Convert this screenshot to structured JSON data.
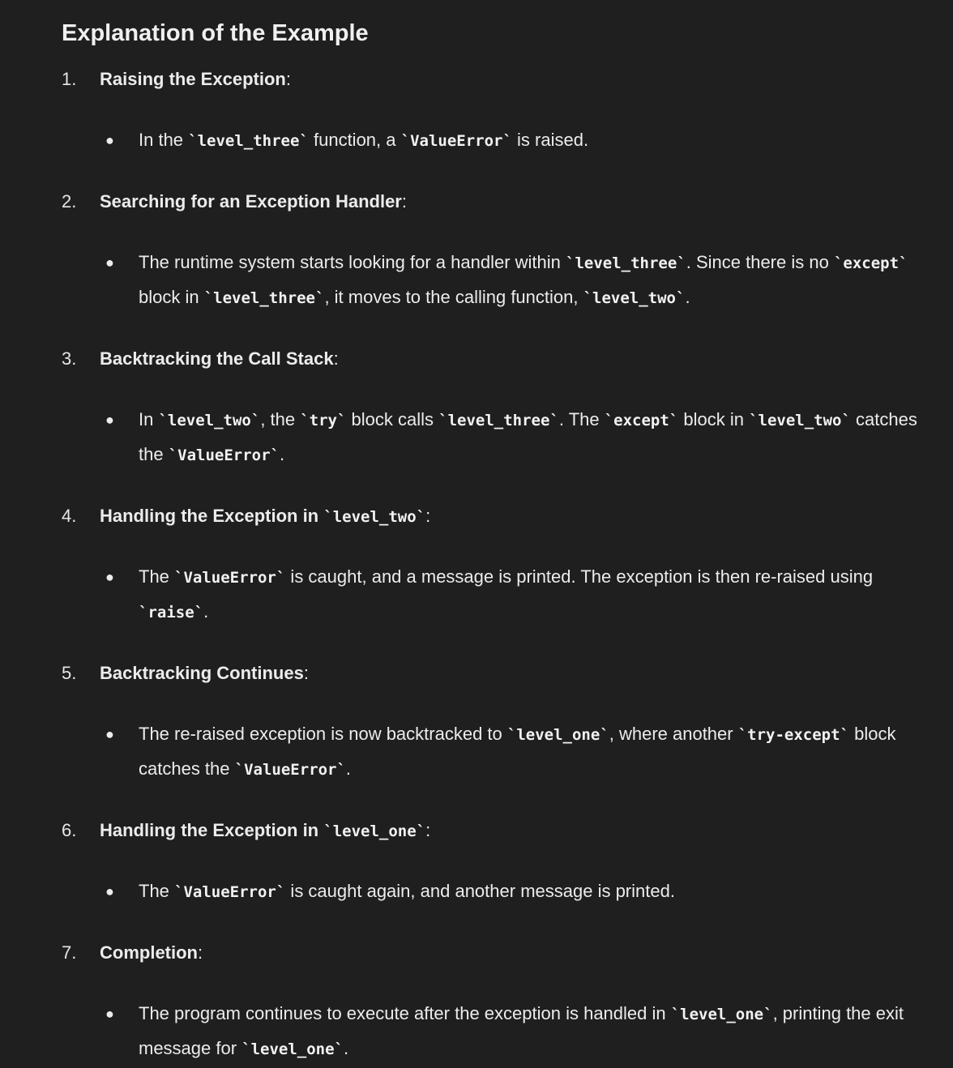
{
  "heading": "Explanation of the Example",
  "steps": [
    {
      "number": "1.",
      "title_bold": "Raising the Exception",
      "title_code": "",
      "title_end": ":",
      "bullet": [
        {
          "t": "In the "
        },
        {
          "c": "`level_three`"
        },
        {
          "t": " function, a "
        },
        {
          "c": "`ValueError`"
        },
        {
          "t": " is raised."
        }
      ]
    },
    {
      "number": "2.",
      "title_bold": "Searching for an Exception Handler",
      "title_code": "",
      "title_end": ":",
      "bullet": [
        {
          "t": "The runtime system starts looking for a handler within "
        },
        {
          "c": "`level_three`"
        },
        {
          "t": ". Since there is no "
        },
        {
          "c": "`except`"
        },
        {
          "t": " block in "
        },
        {
          "c": "`level_three`"
        },
        {
          "t": ", it moves to the calling function, "
        },
        {
          "c": "`level_two`"
        },
        {
          "t": "."
        }
      ]
    },
    {
      "number": "3.",
      "title_bold": "Backtracking the Call Stack",
      "title_code": "",
      "title_end": ":",
      "bullet": [
        {
          "t": "In "
        },
        {
          "c": "`level_two`"
        },
        {
          "t": ", the "
        },
        {
          "c": "`try`"
        },
        {
          "t": " block calls "
        },
        {
          "c": "`level_three`"
        },
        {
          "t": ". The "
        },
        {
          "c": "`except`"
        },
        {
          "t": " block in "
        },
        {
          "c": "`level_two`"
        },
        {
          "t": " catches the "
        },
        {
          "c": "`ValueError`"
        },
        {
          "t": "."
        }
      ]
    },
    {
      "number": "4.",
      "title_bold": "Handling the Exception in ",
      "title_code": "`level_two`",
      "title_end": ":",
      "bullet": [
        {
          "t": "The "
        },
        {
          "c": "`ValueError`"
        },
        {
          "t": " is caught, and a message is printed. The exception is then re-raised using "
        },
        {
          "c": "`raise`"
        },
        {
          "t": "."
        }
      ]
    },
    {
      "number": "5.",
      "title_bold": "Backtracking Continues",
      "title_code": "",
      "title_end": ":",
      "bullet": [
        {
          "t": "The re-raised exception is now backtracked to "
        },
        {
          "c": "`level_one`"
        },
        {
          "t": ", where another "
        },
        {
          "c": "`try-except`"
        },
        {
          "t": " block catches the "
        },
        {
          "c": "`ValueError`"
        },
        {
          "t": "."
        }
      ]
    },
    {
      "number": "6.",
      "title_bold": "Handling the Exception in ",
      "title_code": "`level_one`",
      "title_end": ":",
      "bullet": [
        {
          "t": "The "
        },
        {
          "c": "`ValueError`"
        },
        {
          "t": " is caught again, and another message is printed."
        }
      ]
    },
    {
      "number": "7.",
      "title_bold": "Completion",
      "title_code": "",
      "title_end": ":",
      "bullet": [
        {
          "t": "The program continues to execute after the exception is handled in "
        },
        {
          "c": "`level_one`"
        },
        {
          "t": ", printing the exit message for "
        },
        {
          "c": "`level_one`"
        },
        {
          "t": "."
        }
      ]
    }
  ]
}
